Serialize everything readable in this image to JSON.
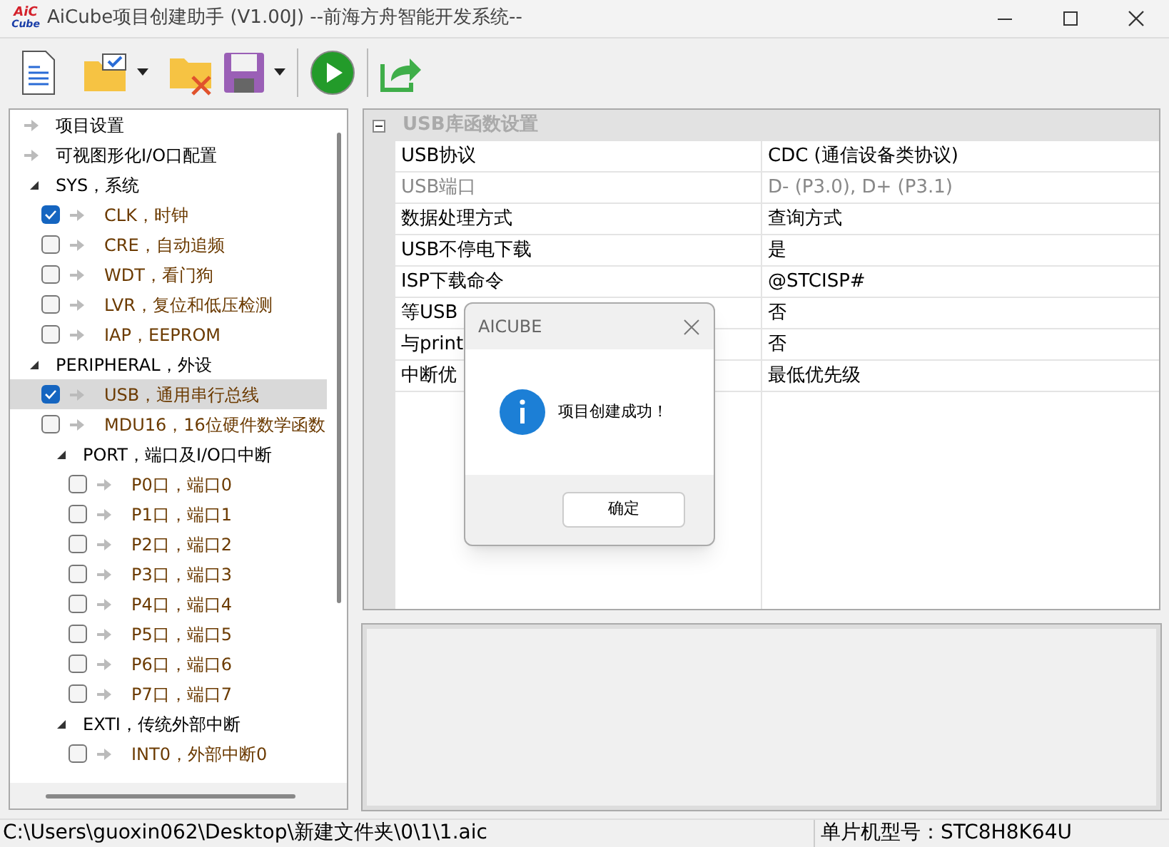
{
  "window": {
    "title": "AiCube项目创建助手 (V1.00J) --前海方舟智能开发系统--",
    "logo_top": "AiC",
    "logo_bottom": "Cube"
  },
  "tree": [
    {
      "label": "项目设置",
      "kind": "page"
    },
    {
      "label": "可视图形化I/O口配置",
      "kind": "page"
    },
    {
      "label": "SYS，系统",
      "kind": "group",
      "expanded": true,
      "children": [
        {
          "label": "CLK，时钟",
          "kind": "module",
          "checked": true,
          "selected": false
        },
        {
          "label": "CRE，自动追频",
          "kind": "module",
          "checked": false,
          "selected": false
        },
        {
          "label": "WDT，看门狗",
          "kind": "module",
          "checked": false,
          "selected": false
        },
        {
          "label": "LVR，复位和低压检测",
          "kind": "module",
          "checked": false,
          "selected": false
        },
        {
          "label": "IAP，EEPROM",
          "kind": "module",
          "checked": false,
          "selected": false
        }
      ]
    },
    {
      "label": "PERIPHERAL，外设",
      "kind": "group",
      "expanded": true,
      "children": [
        {
          "label": "USB，通用串行总线",
          "kind": "module",
          "checked": true,
          "selected": true
        },
        {
          "label": "MDU16，16位硬件数学函数",
          "kind": "module",
          "checked": false,
          "selected": false
        },
        {
          "label": "PORT，端口及I/O口中断",
          "kind": "group",
          "expanded": true,
          "children": [
            {
              "label": "P0口，端口0",
              "kind": "module",
              "checked": false,
              "selected": false
            },
            {
              "label": "P1口，端口1",
              "kind": "module",
              "checked": false,
              "selected": false
            },
            {
              "label": "P2口，端口2",
              "kind": "module",
              "checked": false,
              "selected": false
            },
            {
              "label": "P3口，端口3",
              "kind": "module",
              "checked": false,
              "selected": false
            },
            {
              "label": "P4口，端口4",
              "kind": "module",
              "checked": false,
              "selected": false
            },
            {
              "label": "P5口，端口5",
              "kind": "module",
              "checked": false,
              "selected": false
            },
            {
              "label": "P6口，端口6",
              "kind": "module",
              "checked": false,
              "selected": false
            },
            {
              "label": "P7口，端口7",
              "kind": "module",
              "checked": false,
              "selected": false
            }
          ]
        },
        {
          "label": "EXTI，传统外部中断",
          "kind": "group",
          "expanded": true,
          "children": [
            {
              "label": "INT0，外部中断0",
              "kind": "module",
              "checked": false,
              "selected": false
            }
          ]
        }
      ]
    }
  ],
  "properties": {
    "category": "USB库函数设置",
    "expanded": true,
    "rows": [
      {
        "name": "USB协议",
        "value": "CDC (通信设备类协议)",
        "disabled": false
      },
      {
        "name": "USB端口",
        "value": "D- (P3.0), D+ (P3.1)",
        "disabled": true
      },
      {
        "name": "数据处理方式",
        "value": "查询方式",
        "disabled": false
      },
      {
        "name": "USB不停电下载",
        "value": "是",
        "disabled": false
      },
      {
        "name": "ISP下载命令",
        "value": "@STCISP#",
        "disabled": false
      },
      {
        "name": "等USB",
        "value": "否",
        "disabled": false
      },
      {
        "name": "与print",
        "value": "否",
        "disabled": false
      },
      {
        "name": "中断优",
        "value": "最低优先级",
        "disabled": false
      }
    ]
  },
  "dialog": {
    "title": "AICUBE",
    "message": "项目创建成功！",
    "button": "确定"
  },
  "status_bar": {
    "path": "C:\\Users\\guoxin062\\Desktop\\新建文件夹\\0\\1\\1.aic",
    "chip": "单片机型号：STC8H8K64U"
  }
}
